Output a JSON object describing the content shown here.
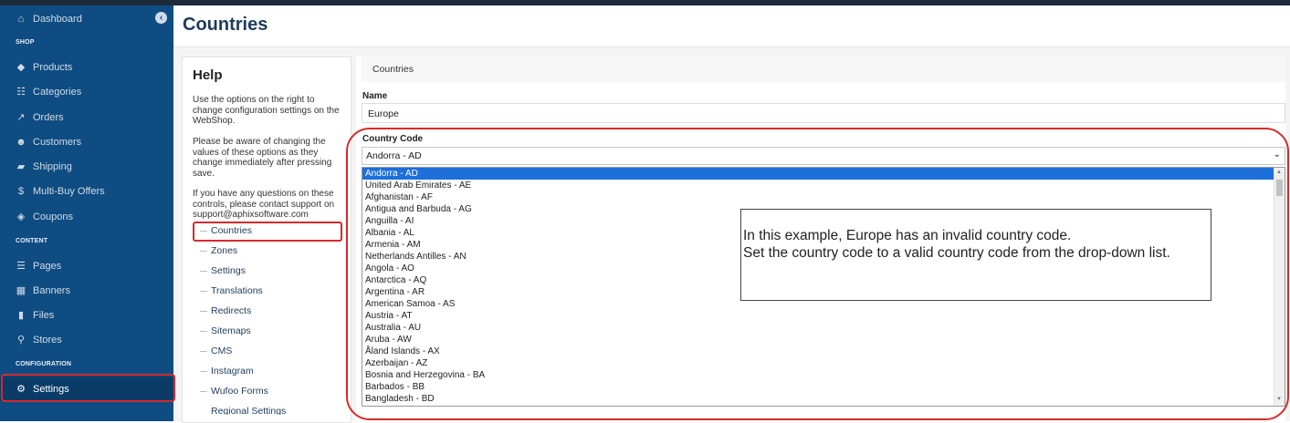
{
  "sidebar": {
    "collapse_icon": "chevron-left-icon",
    "items": [
      {
        "label": "Dashboard",
        "icon": "home-icon",
        "glyph": "⌂"
      },
      {
        "label": "Products",
        "icon": "tags-icon",
        "glyph": "◆"
      },
      {
        "label": "Categories",
        "icon": "sitemap-icon",
        "glyph": "☷"
      },
      {
        "label": "Orders",
        "icon": "chart-line-icon",
        "glyph": "↗"
      },
      {
        "label": "Customers",
        "icon": "users-icon",
        "glyph": "☻"
      },
      {
        "label": "Shipping",
        "icon": "truck-icon",
        "glyph": "▰"
      },
      {
        "label": "Multi-Buy Offers",
        "icon": "dollar-icon",
        "glyph": "$"
      },
      {
        "label": "Coupons",
        "icon": "ticket-icon",
        "glyph": "◈"
      },
      {
        "label": "Pages",
        "icon": "list-icon",
        "glyph": "☰"
      },
      {
        "label": "Banners",
        "icon": "grid-icon",
        "glyph": "▦"
      },
      {
        "label": "Files",
        "icon": "file-icon",
        "glyph": "▮"
      },
      {
        "label": "Stores",
        "icon": "map-marker-icon",
        "glyph": "⚲"
      },
      {
        "label": "Settings",
        "icon": "gear-icon",
        "glyph": "⚙"
      }
    ],
    "sections": {
      "shop": "SHOP",
      "content": "CONTENT",
      "configuration": "CONFIGURATION"
    }
  },
  "page": {
    "title": "Countries"
  },
  "help": {
    "title": "Help",
    "p1": "Use the options on the right to change configuration settings on the WebShop.",
    "p2": "Please be aware of changing the values of these options as they change immediately after pressing save.",
    "p3": "If you have any questions on these controls, please contact support on support@aphixsoftware.com",
    "nav": [
      "Countries",
      "Zones",
      "Settings",
      "Translations",
      "Redirects",
      "Sitemaps",
      "CMS",
      "Instagram",
      "Wufoo Forms",
      "Regional Settings"
    ]
  },
  "form": {
    "breadcrumb": "Countries",
    "name_label": "Name",
    "name_value": "Europe",
    "code_label": "Country Code",
    "code_value": "Andorra - AD",
    "dropdown_icon": "chevron-down-icon",
    "options": [
      "Andorra - AD",
      "United Arab Emirates - AE",
      "Afghanistan - AF",
      "Antigua and Barbuda - AG",
      "Anguilla - AI",
      "Albania - AL",
      "Armenia - AM",
      "Netherlands Antilles - AN",
      "Angola - AO",
      "Antarctica - AQ",
      "Argentina - AR",
      "American Samoa - AS",
      "Austria - AT",
      "Australia - AU",
      "Aruba - AW",
      "Åland Islands - AX",
      "Azerbaijan - AZ",
      "Bosnia and Herzegovina - BA",
      "Barbados - BB",
      "Bangladesh - BD"
    ],
    "selected_option": "Andorra - AD"
  },
  "callout": {
    "line1": "In this example, Europe has an invalid country code.",
    "line2": "Set the country code to a valid country code from the drop-down list."
  },
  "colors": {
    "sidebar": "#0f4c81",
    "annotation": "#d62b2b",
    "selection": "#1e6fd9"
  }
}
